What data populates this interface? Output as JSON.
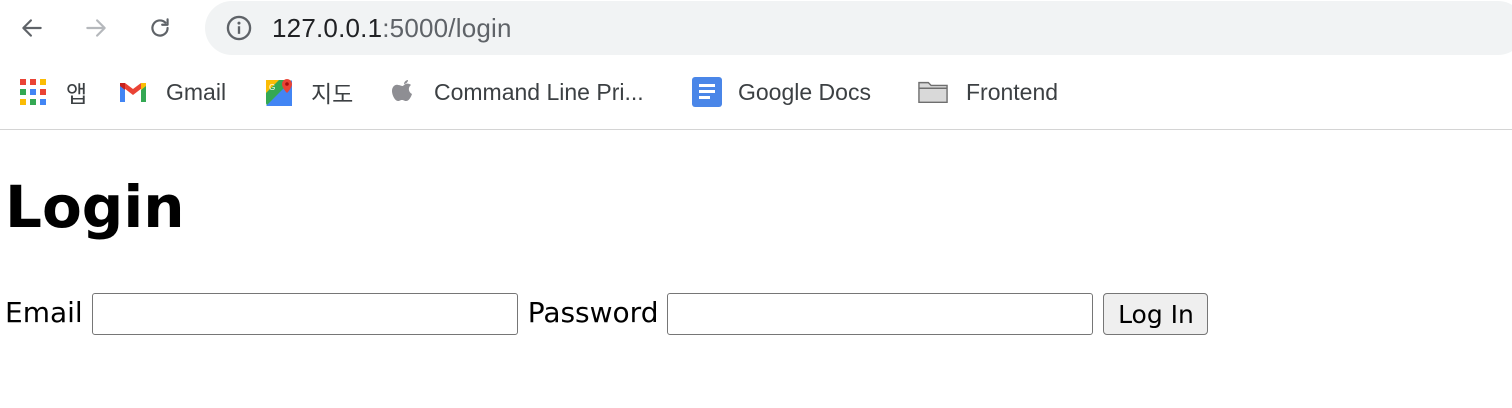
{
  "browser": {
    "url_host": "127.0.0.1",
    "url_path": ":5000/login",
    "bookmarks": [
      {
        "label": "앱",
        "icon": "apps-grid-icon"
      },
      {
        "label": "Gmail",
        "icon": "gmail-icon"
      },
      {
        "label": "지도",
        "icon": "maps-icon"
      },
      {
        "label": "Command Line Pri...",
        "icon": "apple-icon"
      },
      {
        "label": "Google Docs",
        "icon": "google-docs-icon"
      },
      {
        "label": "Frontend",
        "icon": "folder-icon"
      }
    ]
  },
  "page": {
    "title": "Login",
    "email_label": "Email",
    "email_value": "",
    "password_label": "Password",
    "password_value": "",
    "submit_label": "Log In"
  },
  "colors": {
    "omnibox_bg": "#f1f3f4",
    "button_bg": "#efefef",
    "docs_blue": "#4a86e8"
  }
}
